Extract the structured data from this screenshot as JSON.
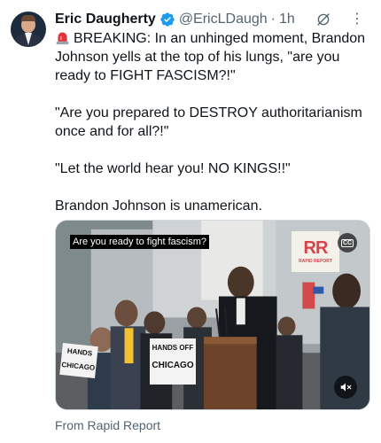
{
  "author": {
    "name": "Eric Daugherty",
    "handle": "@EricLDaugh",
    "separator": "·",
    "time": "1h"
  },
  "icons": {
    "avatar": "profile-photo",
    "verified": "verified-badge-icon",
    "grok": "grok-icon",
    "more": "more-options-icon",
    "siren": "rotating-light-emoji",
    "captions": "closed-captions-icon",
    "mute": "muted-speaker-icon"
  },
  "tweet": {
    "line1": "BREAKING: In an unhinged moment, Brandon Johnson yells at the top of his lungs, \"are you ready to FIGHT FASCISM?!\"",
    "line2": "\"Are you prepared to DESTROY authoritarianism once and for all?!\"",
    "line3": "\"Let the world hear you! NO KINGS!!\"",
    "line4": "Brandon Johnson is unamerican."
  },
  "media": {
    "caption": "Are you ready to fight fascism?",
    "cc_label": "CC",
    "logo_text": "RR",
    "logo_subtext": "RAPID REPORT",
    "sign_left_line1": "HANDS",
    "sign_left_line2": "CHICAGO",
    "sign_center_line1": "HANDS OFF",
    "sign_center_line2": "CHICAGO"
  },
  "source": "From Rapid Report",
  "colors": {
    "verified_blue": "#1d9bf0",
    "secondary_text": "#536471",
    "primary_text": "#0f1419"
  }
}
